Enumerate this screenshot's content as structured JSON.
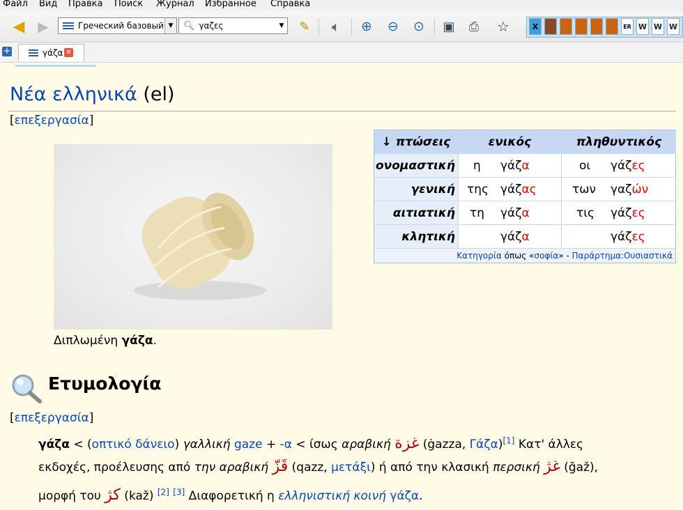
{
  "menu": [
    "Файл",
    "Вид",
    "Правка",
    "Поиск",
    "Журнал",
    "Избранное",
    "Справка"
  ],
  "toolbar": {
    "dictionary_group": "Греческий базовый",
    "search_value": "γαζες"
  },
  "tab": {
    "label": "γάζα"
  },
  "section": {
    "heading": "Νέα ελληνικά",
    "lang_code": "(el)",
    "edit_label": "επεξεργασία"
  },
  "figure": {
    "caption_prefix": "Διπλωμένη ",
    "caption_bold": "γάζα",
    "caption_suffix": "."
  },
  "declension": {
    "col_cases": "↓ πτώσεις",
    "col_singular": "ενικός",
    "col_plural": "πληθυντικός",
    "rows": [
      {
        "case": "ονομαστική",
        "s_art": "η",
        "s_stem": "γάζ",
        "s_end": "α",
        "p_art": "οι",
        "p_stem": "γάζ",
        "p_end": "ες"
      },
      {
        "case": "γενική",
        "s_art": "της",
        "s_stem": "γάζ",
        "s_end": "ας",
        "p_art": "των",
        "p_stem": "γαζ",
        "p_end": "ών"
      },
      {
        "case": "αιτιατική",
        "s_art": "τη",
        "s_stem": "γάζ",
        "s_end": "α",
        "p_art": "τις",
        "p_stem": "γάζ",
        "p_end": "ες"
      },
      {
        "case": "κλητική",
        "s_art": "",
        "s_stem": "γάζ",
        "s_end": "α",
        "p_art": "",
        "p_stem": "γάζ",
        "p_end": "ες"
      }
    ],
    "footer_cat": "Κατηγορία",
    "footer_mid": " όπως «",
    "footer_word": "σοφία",
    "footer_after": "» - ",
    "footer_app": "Παράρτημα:Ουσιαστικά"
  },
  "etymology": {
    "title": "Ετυμολογία",
    "edit_label": "επεξεργασία",
    "l1": {
      "word": "γάζα",
      "t1": " < (",
      "link1": "οπτικό δάνειο",
      "t2": ") ",
      "lang1": "γαλλική",
      "t3": " ",
      "link2": "gaze",
      "t4": " + ",
      "link3": "-α",
      "t5": " < ίσως ",
      "lang2": "αραβική",
      "t6": " ",
      "arab1": "غزة",
      "t7": " (ġazza, ",
      "link4": "Γάζα",
      "t8": ")",
      "ref1": "[1]",
      "t9": " Κατ' άλλες"
    },
    "l2": {
      "t1": "εκδοχές, προέλευσης από ",
      "lang3": "την αραβική",
      "t2": " ",
      "arab2": "قَزّ",
      "t3": " (qazz, ",
      "link5": "μετάξι",
      "t4": ") ή από την κλασική ",
      "lang4": "περσική",
      "t5": " ",
      "arab3": "غژ",
      "t6": " (ğaž),"
    },
    "l3": {
      "t1": "μορφή του ",
      "arab4": "کژ",
      "t2": " (kaž) ",
      "ref2": "[2]",
      "t3": " ",
      "ref3": "[3]",
      "t4": " Διαφορετική η ",
      "link6": "ελληνιστική κοινή",
      "t5": " ",
      "link7": "γάζα",
      "t6": "."
    }
  }
}
